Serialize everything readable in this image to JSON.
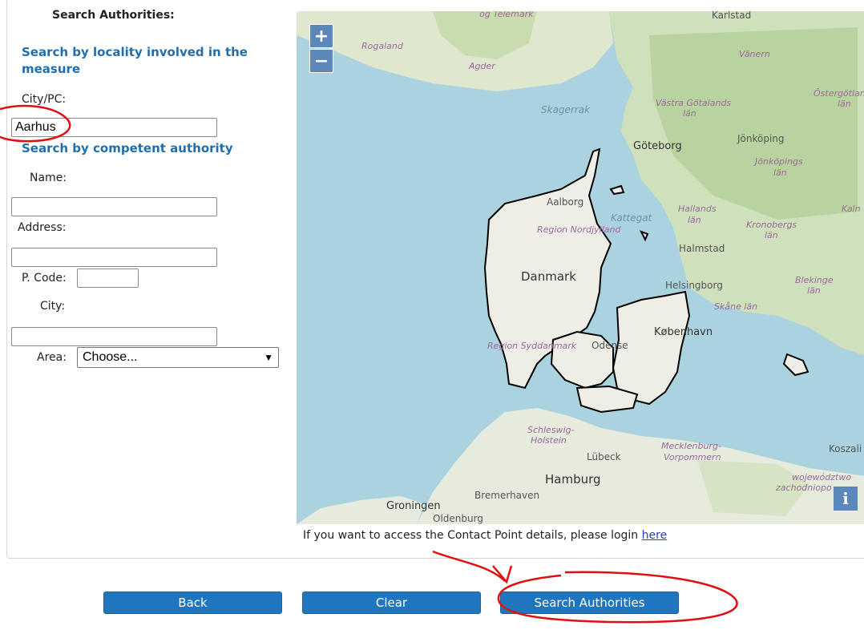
{
  "form": {
    "title": "Search Authorities:",
    "locality_heading": "Search by locality involved in the measure",
    "city_pc_label": "City/PC:",
    "city_pc_value": "Aarhus",
    "authority_heading": "Search by competent authority",
    "name_label": "Name:",
    "address_label": "Address:",
    "pcode_label": "P. Code:",
    "city_label": "City:",
    "area_label": "Area:",
    "area_selected": "Choose..."
  },
  "map": {
    "zoom_in": "+",
    "zoom_out": "−",
    "info": "i",
    "labels": {
      "telemark": "og Telemark",
      "karlstad": "Karlstad",
      "rogaland": "Rogaland",
      "agder": "Agder",
      "vanern": "Vänern",
      "ostergotland": "Östergötland",
      "ostergotland_lan": "län",
      "skagerrak": "Skagerrak",
      "vastra": "Västra Götalands",
      "vastra_lan": "län",
      "goteborg": "Göteborg",
      "jonkoping": "Jönköping",
      "jonkopings": "Jönköpings",
      "jonkopings_lan": "län",
      "aalborg": "Aalborg",
      "kattegat": "Kattegat",
      "nordjylland": "Region Nordjylland",
      "hallands": "Hallands",
      "hallands_lan": "län",
      "kronobergs": "Kronobergs",
      "kronobergs_lan": "län",
      "kaln": "Kaln",
      "halmstad": "Halmstad",
      "danmark": "Danmark",
      "helsingborg": "Helsingborg",
      "blekinge": "Blekinge",
      "blekinge_lan": "län",
      "skane": "Skåne län",
      "kobenhavn": "København",
      "syddanmark": "Region Syddanmark",
      "odense": "Odense",
      "schleswig": "Schleswig-",
      "holstein": "Holstein",
      "mecklenburg": "Mecklenburg-",
      "vorpommern": "Vorpommern",
      "koszalin": "Koszali",
      "lubeck": "Lübeck",
      "hamburg": "Hamburg",
      "wojewodztwo": "województwo",
      "zachodniopo": "zachodniopo",
      "bremerhaven": "Bremerhaven",
      "groningen": "Groningen",
      "oldenburg": "Oldenburg"
    }
  },
  "footer": {
    "text": "If you want to access the Contact Point details, please login",
    "link": "here"
  },
  "buttons": {
    "back": "Back",
    "clear": "Clear",
    "search": "Search Authorities"
  },
  "colors": {
    "heading_blue": "#1f6fae",
    "button_blue": "#1f75be",
    "annotation_red": "#e01010",
    "sea": "#aad3df"
  }
}
